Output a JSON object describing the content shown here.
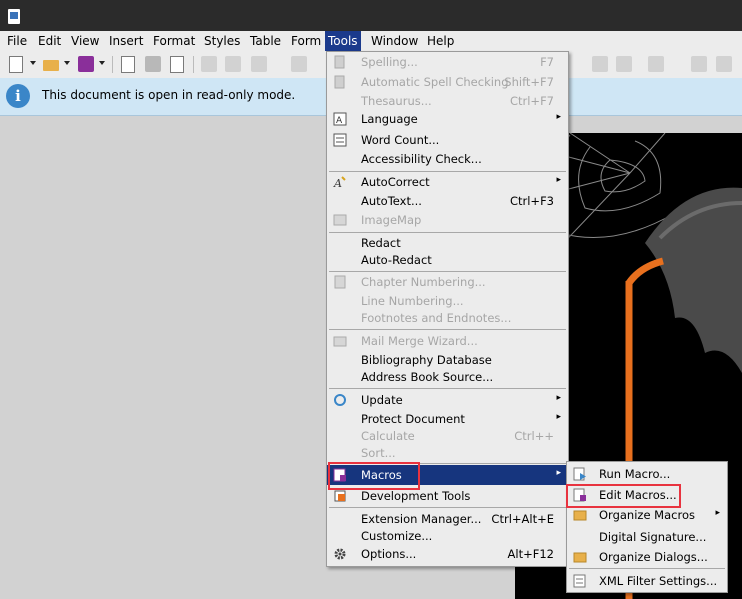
{
  "menubar": {
    "items": [
      "File",
      "Edit",
      "View",
      "Insert",
      "Format",
      "Styles",
      "Table",
      "Form",
      "Tools",
      "Window",
      "Help"
    ],
    "active": "Tools"
  },
  "infobar": {
    "message": "This document is open in read-only mode."
  },
  "tools_menu": {
    "items": [
      {
        "label": "Spelling...",
        "shortcut": "F7",
        "disabled": true,
        "icon": "spelling-icon"
      },
      {
        "label": "Automatic Spell Checking",
        "shortcut": "Shift+F7",
        "disabled": true,
        "icon": "auto-spell-icon"
      },
      {
        "label": "Thesaurus...",
        "shortcut": "Ctrl+F7",
        "disabled": true,
        "icon": ""
      },
      {
        "label": "Language",
        "submenu": true,
        "icon": "language-icon"
      },
      {
        "label": "Word Count...",
        "icon": "word-count-icon"
      },
      {
        "label": "Accessibility Check...",
        "icon": ""
      },
      {
        "label": "AutoCorrect",
        "submenu": true,
        "icon": "autocorrect-icon"
      },
      {
        "label": "AutoText...",
        "shortcut": "Ctrl+F3",
        "icon": ""
      },
      {
        "label": "ImageMap",
        "disabled": true,
        "icon": "imagemap-icon"
      },
      {
        "label": "Redact",
        "icon": ""
      },
      {
        "label": "Auto-Redact",
        "icon": ""
      },
      {
        "label": "Chapter Numbering...",
        "disabled": true,
        "icon": "chapter-numbering-icon"
      },
      {
        "label": "Line Numbering...",
        "disabled": true,
        "icon": ""
      },
      {
        "label": "Footnotes and Endnotes...",
        "disabled": true,
        "icon": ""
      },
      {
        "label": "Mail Merge Wizard...",
        "disabled": true,
        "icon": "mail-merge-icon"
      },
      {
        "label": "Bibliography Database",
        "icon": ""
      },
      {
        "label": "Address Book Source...",
        "icon": ""
      },
      {
        "label": "Update",
        "submenu": true,
        "icon": "update-icon"
      },
      {
        "label": "Protect Document",
        "submenu": true,
        "icon": ""
      },
      {
        "label": "Calculate",
        "shortcut": "Ctrl++",
        "disabled": true,
        "icon": ""
      },
      {
        "label": "Sort...",
        "disabled": true,
        "icon": ""
      },
      {
        "label": "Macros",
        "submenu": true,
        "highlighted": true,
        "icon": "macros-icon"
      },
      {
        "label": "Development Tools",
        "icon": "development-tools-icon"
      },
      {
        "label": "Extension Manager...",
        "shortcut": "Ctrl+Alt+E",
        "icon": ""
      },
      {
        "label": "Customize...",
        "icon": ""
      },
      {
        "label": "Options...",
        "shortcut": "Alt+F12",
        "icon": "options-gear-icon"
      }
    ]
  },
  "macros_submenu": {
    "items": [
      {
        "label": "Run Macro...",
        "icon": "run-macro-icon"
      },
      {
        "label": "Edit Macros...",
        "icon": "edit-macros-icon",
        "boxed": true
      },
      {
        "label": "Organize Macros",
        "submenu": true,
        "icon": "organize-macros-icon"
      },
      {
        "label": "Digital Signature...",
        "icon": ""
      },
      {
        "label": "Organize Dialogs...",
        "icon": "organize-dialogs-icon"
      },
      {
        "label": "XML Filter Settings...",
        "icon": "xml-filter-icon"
      }
    ]
  },
  "colors": {
    "highlight": "#16357e",
    "annotation": "#e8333f",
    "info_bg": "#cfe6f5",
    "accent_orange": "#e8701e"
  }
}
